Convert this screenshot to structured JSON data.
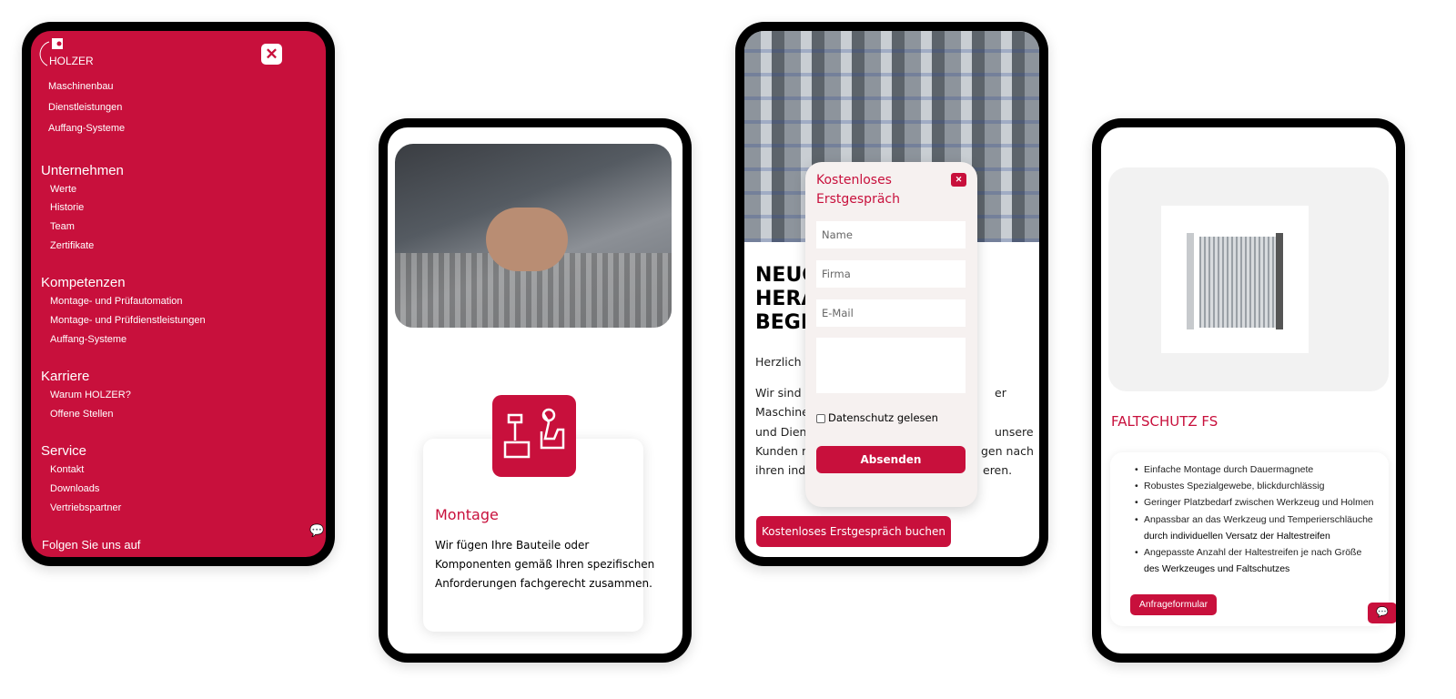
{
  "colors": {
    "brand": "#c8103c",
    "frame": "#000000"
  },
  "phone1": {
    "logo": "HOLZER",
    "close_icon": "close-icon",
    "top_items": [
      "Maschinenbau",
      "Dienstleistungen",
      "Auffang-Systeme"
    ],
    "sections": [
      {
        "title": "Unternehmen",
        "items": [
          "Werte",
          "Historie",
          "Team",
          "Zertifikate"
        ]
      },
      {
        "title": "Kompetenzen",
        "items": [
          "Montage- und Prüfautomation",
          "Montage- und Prüfdienstleistungen",
          "Auffang-Systeme"
        ]
      },
      {
        "title": "Karriere",
        "items": [
          "Warum HOLZER?",
          "Offene Stellen"
        ]
      },
      {
        "title": "Service",
        "items": [
          "Kontakt",
          "Downloads",
          "Vertriebspartner"
        ]
      }
    ],
    "footer": "Folgen Sie uns auf",
    "chat_icon": "chat-icon"
  },
  "phone2": {
    "card_title": "Montage",
    "card_text": [
      "Wir fügen Ihre Bauteile oder",
      "Komponenten gemäß Ihren spezifischen",
      "Anforderungen fachgerecht zusammen."
    ],
    "icon": "assembly-tools-icon"
  },
  "phone3": {
    "heading": [
      "NEUG",
      "HERAU",
      "BEGEI"
    ],
    "greeting": "Herzlich W",
    "para_left": [
      "Wir sind ei",
      "Maschiner",
      "und Diens",
      "Kunden m",
      "ihren indiv"
    ],
    "para_right": [
      "er",
      "",
      "unsere",
      "gen nach",
      "eren."
    ],
    "modal": {
      "title_line1": "Kostenloses",
      "title_line2": "Erstgespräch",
      "name_placeholder": "Name",
      "company_placeholder": "Firma",
      "email_placeholder": "E-Mail",
      "privacy_label": "Datenschutz gelesen",
      "submit": "Absenden"
    },
    "cta": "Kostenloses Erstgespräch buchen"
  },
  "phone4": {
    "product_title": "FALTSCHUTZ FS",
    "bullets": [
      "Einfache Montage durch Dauermagnete",
      "Robustes Spezialgewebe, blickdurchlässig",
      "Geringer Platzbedarf zwischen Werkzeug und Holmen",
      "Anpassbar an das Werkzeug und Temperierschläuche",
      "durch individuellen Versatz der Haltestreifen",
      "Angepasste Anzahl der Haltestreifen je nach Größe",
      "des Werkzeuges und Faltschutzes"
    ],
    "button": "Anfrageformular",
    "chat_icon": "chat-icon"
  }
}
